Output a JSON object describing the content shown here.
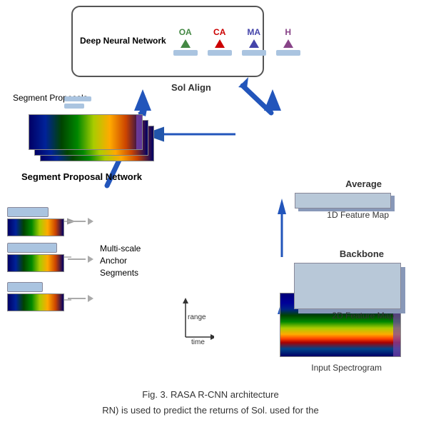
{
  "diagram": {
    "title": "Deep Neural Network",
    "outputs": [
      {
        "label": "OA",
        "color": "#448844",
        "arrowColor": "#448844"
      },
      {
        "label": "CA",
        "color": "#cc0000",
        "arrowColor": "#cc0000"
      },
      {
        "label": "MA",
        "color": "#4444aa",
        "arrowColor": "#4444aa"
      },
      {
        "label": "H",
        "color": "#884488",
        "arrowColor": "#884488"
      }
    ],
    "solAlign": "Sol Align",
    "segmentProposals": "Segment Proposals",
    "segmentProposalNetwork": "Segment Proposal Network",
    "multiScaleAnchor": "Multi-scale\nAnchor\nSegments",
    "featureMap1D": "1D Feature Map",
    "featureMap2D": "2D Feature Map",
    "average": "Average",
    "backbone": "Backbone",
    "inputSpectrogram": "Input Spectrogram",
    "rangeLabel": "range",
    "timeLabel": "time",
    "caption": "Fig. 3. RASA R-CNN architecture",
    "bottomText": "RN) is used to predict the returns of Sol. used for the"
  }
}
